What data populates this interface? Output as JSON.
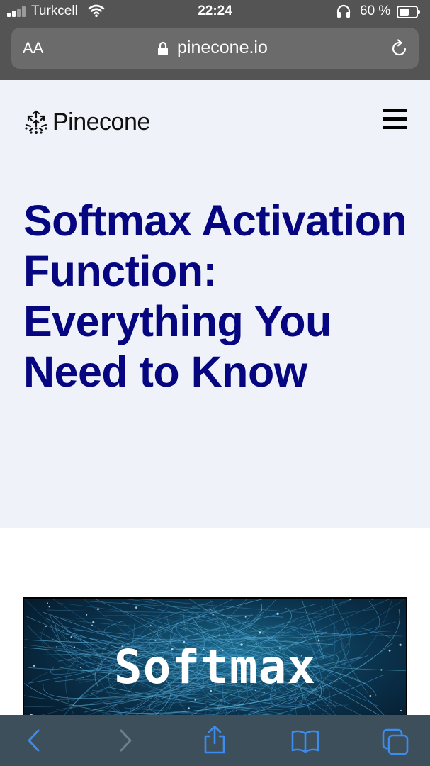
{
  "status_bar": {
    "carrier": "Turkcell",
    "time": "22:24",
    "battery_percent": "60 %",
    "battery_level": 0.6,
    "signal_bars": 2,
    "icons": [
      "signal-icon",
      "wifi-icon",
      "headphones-icon",
      "battery-icon"
    ]
  },
  "browser": {
    "text_size_label": "AA",
    "url": "pinecone.io",
    "icons": [
      "lock-icon",
      "reload-icon"
    ]
  },
  "site": {
    "logo_text": "Pinecone",
    "logo_icon": "pinecone-logo-icon",
    "menu_icon": "hamburger-menu-icon"
  },
  "article": {
    "title": "Softmax Activation Function: Everything You Need to Know",
    "image_caption": "Softmax"
  },
  "toolbar": {
    "icons": [
      "back-icon",
      "forward-icon",
      "share-icon",
      "bookmarks-icon",
      "tabs-icon"
    ]
  },
  "colors": {
    "title": "#050680",
    "hero_background": "#eff2f8",
    "toolbar_icons": "#3b8cf0"
  }
}
